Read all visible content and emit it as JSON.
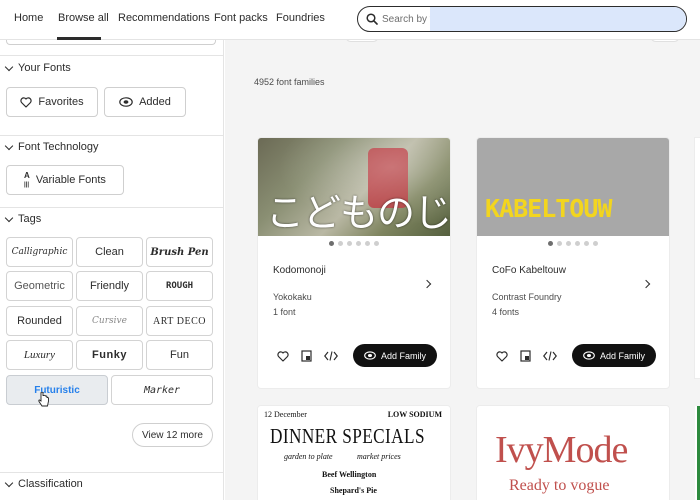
{
  "topnav": {
    "items": [
      "Home",
      "Browse all",
      "Recommendations",
      "Font packs",
      "Foundries"
    ],
    "search_placeholder": "Search by fo"
  },
  "sidebar": {
    "sections": {
      "your_fonts": "Your Fonts",
      "font_technology": "Font Technology",
      "tags": "Tags",
      "classification": "Classification"
    },
    "your_fonts_buttons": [
      "Favorites",
      "Added"
    ],
    "tech_button": "Variable Fonts",
    "tags": [
      "Calligraphic",
      "Clean",
      "Brush Pen",
      "Geometric",
      "Friendly",
      "ROUGH",
      "Rounded",
      "Cursive",
      "ART DECO",
      "Luxury",
      "Funky",
      "Fun",
      "Futuristic",
      "Marker"
    ],
    "selected_tag": "Futuristic",
    "view_more": "View 12 more"
  },
  "main": {
    "count": "4952 font families",
    "cards": [
      {
        "preview_text": "こどものじ",
        "name": "Kodomonoji",
        "foundry": "Yokokaku",
        "fonts": "1 font",
        "add_label": "Add Family"
      },
      {
        "preview_text": "KABELTOUW",
        "name": "CoFo Kabeltouw",
        "foundry": "Contrast Foundry",
        "fonts": "4 fonts",
        "add_label": "Add Family"
      }
    ],
    "bottom_cards": {
      "dinner": {
        "left_top": "12 December",
        "right_top": "LOW SODIUM",
        "title": "DINNER SPECIALS",
        "sub_left": "garden to plate",
        "sub_right": "market prices",
        "line1": "Beef Wellington",
        "line2": "Shepard's Pie"
      },
      "ivy": {
        "title": "IvyMode",
        "tagline": "Ready to vogue"
      }
    }
  },
  "colors": {
    "accent_blue": "#2680eb",
    "button_black": "#111111",
    "kabeltouw_yellow": "#f2d51f",
    "ivymode_red": "#c0504d"
  }
}
